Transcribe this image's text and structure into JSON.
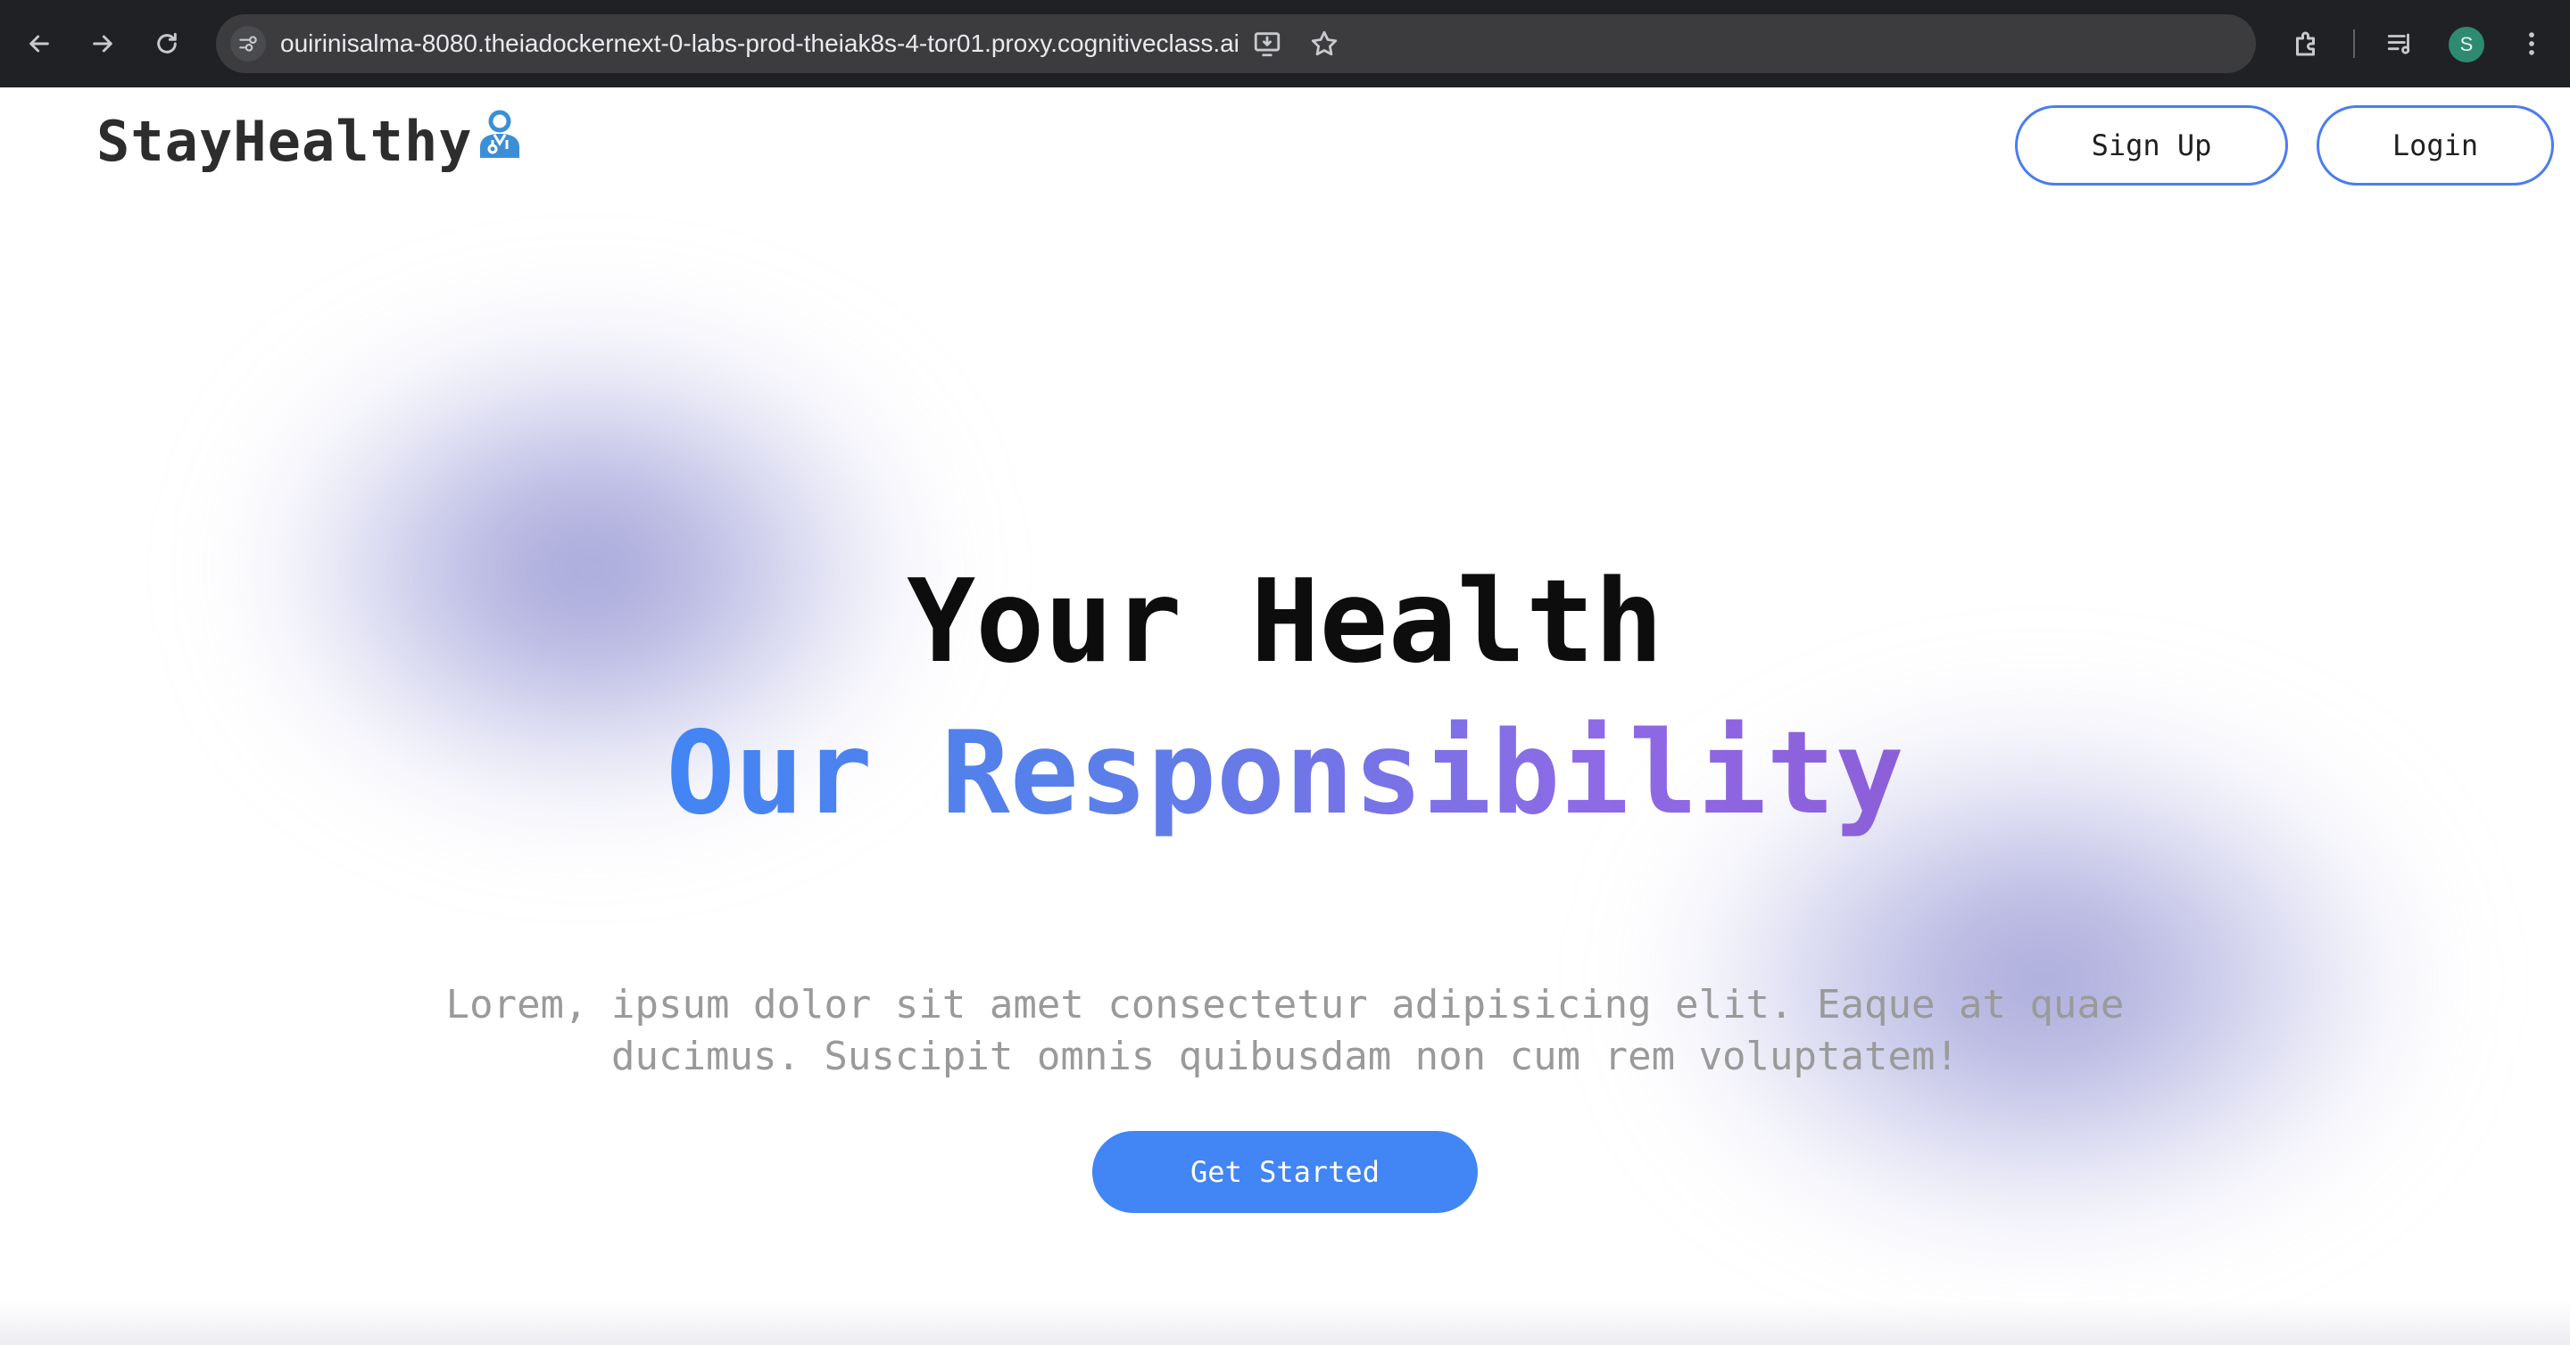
{
  "browser": {
    "url": "ouirinisalma-8080.theiadockernext-0-labs-prod-theiak8s-4-tor01.proxy.cognitiveclass.ai",
    "profile_initial": "S",
    "icons": [
      "back-icon",
      "forward-icon",
      "reload-icon",
      "site-info-icon",
      "install-app-icon",
      "bookmark-star-icon",
      "extensions-icon",
      "media-controls-icon",
      "profile-avatar",
      "menu-icon"
    ]
  },
  "navbar": {
    "logo_text": "StayHealthy",
    "logo_icon": "doctor-icon",
    "signup_label": "Sign Up",
    "login_label": "Login"
  },
  "hero": {
    "title_line1": "Your Health",
    "title_line2": "Our Responsibility",
    "description_line1": "Lorem, ipsum dolor sit amet consectetur adipisicing elit. Eaque at quae",
    "description_line2": "ducimus. Suscipit omnis quibusdam non cum rem voluptatem!",
    "cta_label": "Get Started"
  },
  "colors": {
    "accent": "#4285f4",
    "gradient_start": "#4285f4",
    "gradient_end": "#8c5fd8",
    "button_border": "#4a7df0",
    "chrome_bg": "#202124"
  }
}
